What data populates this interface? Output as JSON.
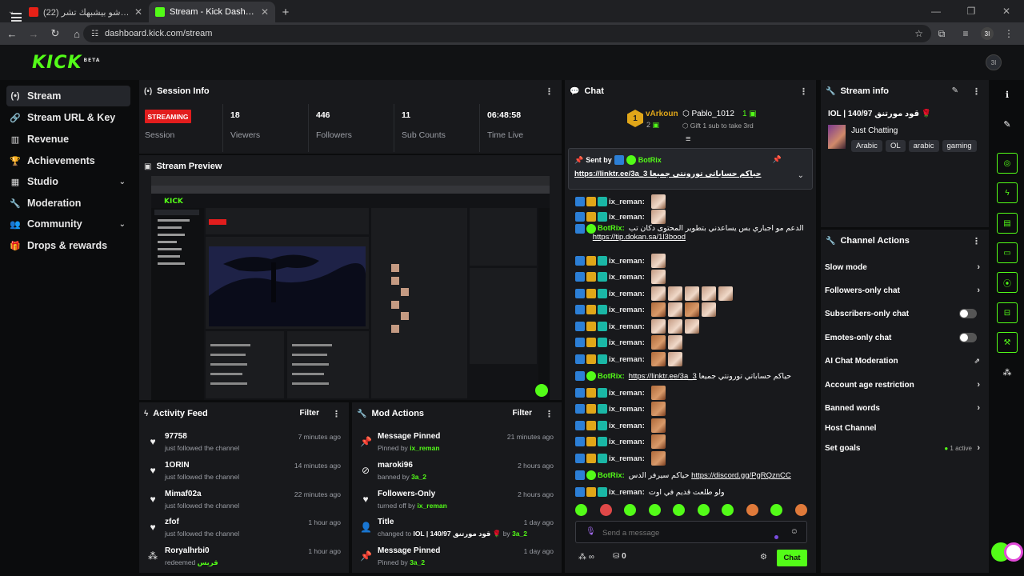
{
  "browser": {
    "tabs": [
      {
        "title": "(22) زين عبيد – شو بيشبهك تشر…",
        "active": false
      },
      {
        "title": "Stream - Kick Dashboard",
        "active": true
      }
    ],
    "new_tab": "+",
    "url": "dashboard.kick.com/stream",
    "profile": "3I"
  },
  "app": {
    "logo": "KICK",
    "logo_badge": "BETA",
    "user_avatar": "3I"
  },
  "sidebar": {
    "items": [
      {
        "label": "Stream",
        "icon": "broadcast-icon",
        "active": true
      },
      {
        "label": "Stream URL & Key",
        "icon": "link-icon"
      },
      {
        "label": "Revenue",
        "icon": "chart-icon"
      },
      {
        "label": "Achievements",
        "icon": "trophy-icon"
      },
      {
        "label": "Studio",
        "icon": "film-icon",
        "expandable": true
      },
      {
        "label": "Moderation",
        "icon": "wrench-icon"
      },
      {
        "label": "Community",
        "icon": "users-icon",
        "expandable": true
      },
      {
        "label": "Drops & rewards",
        "icon": "gift-icon"
      }
    ]
  },
  "session": {
    "title": "Session Info",
    "status": "STREAMING",
    "status_label": "Session",
    "stats": [
      {
        "value": "18",
        "label": "Viewers"
      },
      {
        "value": "446",
        "label": "Followers"
      },
      {
        "value": "11",
        "label": "Sub Counts"
      },
      {
        "value": "06:48:58",
        "label": "Time Live"
      }
    ]
  },
  "preview": {
    "title": "Stream Preview"
  },
  "activity": {
    "title": "Activity Feed",
    "filter": "Filter",
    "items": [
      {
        "name": "97758",
        "desc": "just followed the channel",
        "time": "7 minutes ago",
        "icon": "heart-icon"
      },
      {
        "name": "1ORIN",
        "desc": "just followed the channel",
        "time": "14 minutes ago",
        "icon": "heart-icon"
      },
      {
        "name": "Mimaf02a",
        "desc": "just followed the channel",
        "time": "22 minutes ago",
        "icon": "heart-icon"
      },
      {
        "name": "zfof",
        "desc": "just followed the channel",
        "time": "1 hour ago",
        "icon": "heart-icon"
      },
      {
        "name": "Roryalhrbi0",
        "desc": "redeemed",
        "extra": "قريس",
        "time": "1 hour ago",
        "icon": "reward-icon"
      }
    ]
  },
  "mod": {
    "title": "Mod Actions",
    "filter": "Filter",
    "items": [
      {
        "name": "Message Pinned",
        "desc": "Pinned by",
        "who": "ix_reman",
        "time": "21 minutes ago",
        "icon": "pin-icon"
      },
      {
        "name": "maroki96",
        "desc": "banned by",
        "who": "3a_2",
        "time": "2 hours ago",
        "icon": "ban-icon"
      },
      {
        "name": "Followers-Only",
        "desc": "turned off by",
        "who": "ix_reman",
        "time": "2 hours ago",
        "icon": "heart-icon"
      },
      {
        "name": "Title",
        "desc": "changed to",
        "who": "IOL | 140/97 قود مورتنق 🌹",
        "who2_prefix": "by",
        "who2": "3a_2",
        "time": "1 day ago",
        "icon": "person-icon"
      },
      {
        "name": "Message Pinned",
        "desc": "Pinned by",
        "who": "3a_2",
        "time": "1 day ago",
        "icon": "pin-icon"
      }
    ]
  },
  "chat": {
    "title": "Chat",
    "gifters": [
      {
        "name": "vArkoun",
        "count": "2",
        "rank": "1"
      },
      {
        "name": "Pablo_1012",
        "count": "1"
      }
    ],
    "gift_prompt": "Gift 1 sub to take 3rd",
    "pinned": {
      "sent_by_label": "Sent by",
      "sender": "BotRix",
      "text": "https://linktr.ee/3a_3 حياكم حساباتي تورونتي جميعا"
    },
    "messages": [
      {
        "user": "ix_reman:",
        "emotes": 1
      },
      {
        "user": "ix_reman:",
        "emotes": 1
      },
      {
        "user": "BotRix:",
        "bot": true,
        "text": "الدعم مو اجباري بس يساعدني بتطوير المحتوى دكان تب",
        "link": "https://tip.dokan.sa/1l3bood"
      },
      {
        "user": "ix_reman:",
        "emotes": 1
      },
      {
        "user": "ix_reman:",
        "emotes": 1
      },
      {
        "user": "ix_reman:",
        "emotes": 5
      },
      {
        "user": "ix_reman:",
        "emotes": 4
      },
      {
        "user": "ix_reman:",
        "emotes": 3
      },
      {
        "user": "ix_reman:",
        "emotes": 2
      },
      {
        "user": "ix_reman:",
        "emotes": 2
      },
      {
        "user": "BotRix:",
        "bot": true,
        "link": "https://linktr.ee/3a_3",
        "text": "حياكم حساباتي تورونتي جميعا"
      },
      {
        "user": "ix_reman:",
        "emotes": 1
      },
      {
        "user": "ix_reman:",
        "emotes": 1
      },
      {
        "user": "ix_reman:",
        "emotes": 1
      },
      {
        "user": "ix_reman:",
        "emotes": 1
      },
      {
        "user": "ix_reman:",
        "emotes": 1
      },
      {
        "user": "BotRix:",
        "bot": true,
        "text": "حياكم سيرفر الدس",
        "link": "https://discord.gg/PgRQznCC"
      },
      {
        "user": "ix_reman:",
        "text": "ولو طلعت قديم في اوت"
      }
    ],
    "input_placeholder": "Send a message",
    "points": "0",
    "send_label": "Chat"
  },
  "stream_info": {
    "title": "Stream info",
    "stream_title": "IOL | 140/97 قود مورتنق 🌹",
    "category": "Just Chatting",
    "tags": [
      "Arabic",
      "OL",
      "arabic",
      "gaming"
    ]
  },
  "channel_actions": {
    "title": "Channel Actions",
    "items": [
      {
        "label": "Slow mode",
        "control": "chevron"
      },
      {
        "label": "Followers-only chat",
        "control": "chevron"
      },
      {
        "label": "Subscribers-only chat",
        "control": "toggle"
      },
      {
        "label": "Emotes-only chat",
        "control": "toggle"
      },
      {
        "label": "AI Chat Moderation",
        "control": "external"
      },
      {
        "label": "Account age restriction",
        "control": "chevron"
      },
      {
        "label": "Banned words",
        "control": "chevron"
      },
      {
        "label": "Host Channel",
        "control": "none"
      },
      {
        "label": "Set goals",
        "control": "chevron",
        "status": "1 active"
      }
    ]
  },
  "colors": {
    "brand": "#53fc18",
    "live": "#e21d1d",
    "panel": "#18191c",
    "bg": "#0b0c0d"
  }
}
